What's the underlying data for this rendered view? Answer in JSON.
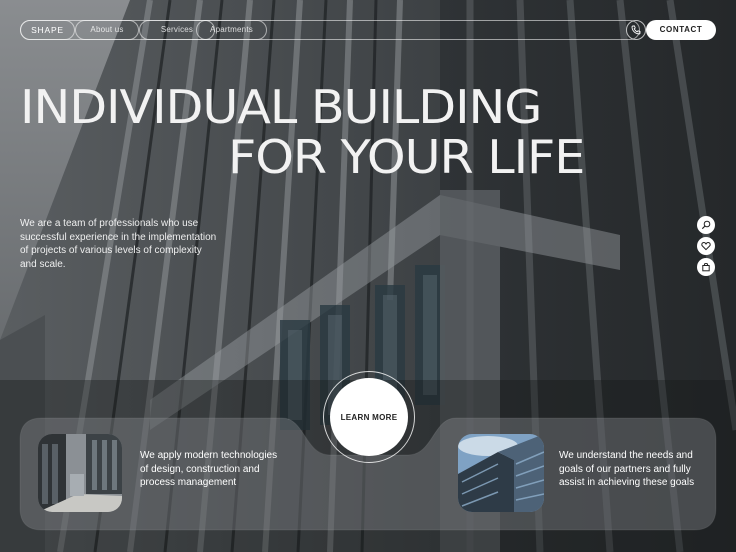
{
  "nav": {
    "brand": "SHAPE",
    "items": [
      {
        "label": "About us"
      },
      {
        "label": "Services"
      },
      {
        "label": "Apartments"
      }
    ],
    "contact_label": "CONTACT"
  },
  "hero": {
    "title_line1": "INDIVIDUAL BUILDING",
    "title_line2": "FOR YOUR LIFE",
    "description": "We are a team of professionals who use successful experience in the implementation of projects of various levels of complexity and scale."
  },
  "side_icons": [
    "search-icon",
    "heart-icon",
    "bag-icon"
  ],
  "cta": {
    "learn_more": "LEARN MORE"
  },
  "cards": [
    {
      "text": "We apply modern technologies of design, construction and process management"
    },
    {
      "text": "We understand the needs and goals of our partners and fully assist in achieving these goals"
    }
  ]
}
